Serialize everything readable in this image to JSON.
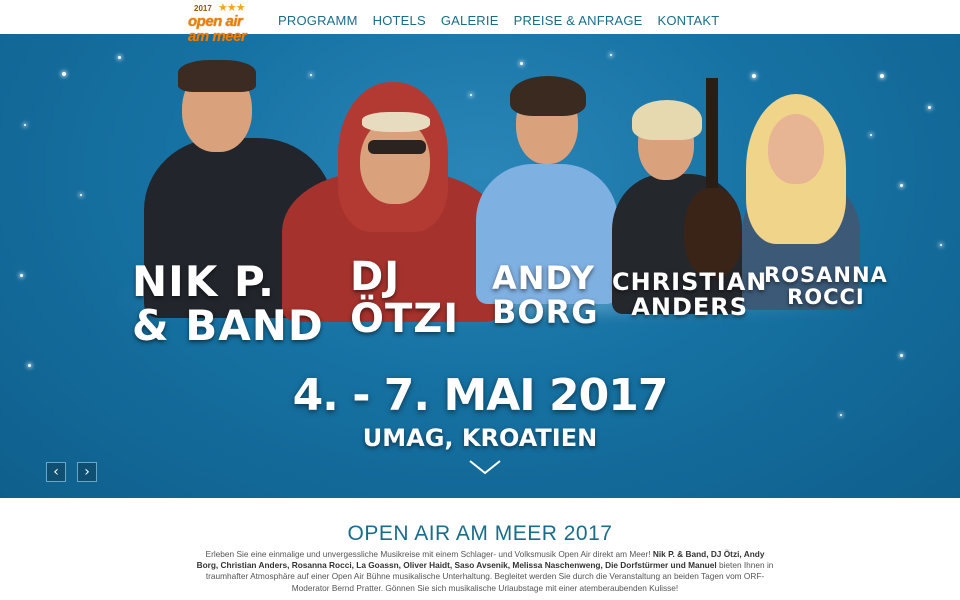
{
  "brand": {
    "logo_year": "2017",
    "logo_stars": "★★★",
    "logo_line1": "open air",
    "logo_line2": "am meer",
    "colors": {
      "logo_orange": "#ee7f00",
      "nav_blue": "#1a6d8a",
      "hero_blue": "#1672a3"
    }
  },
  "nav": {
    "items": [
      {
        "label": "PROGRAMM"
      },
      {
        "label": "HOTELS"
      },
      {
        "label": "GALERIE"
      },
      {
        "label": "PREISE & ANFRAGE"
      },
      {
        "label": "KONTAKT"
      }
    ]
  },
  "hero": {
    "artists": [
      {
        "name": "NIK P.\n& BAND"
      },
      {
        "name": "DJ\nÖTZI"
      },
      {
        "name": "ANDY\nBORG"
      },
      {
        "name": "CHRISTIAN\nANDERS"
      },
      {
        "name": "ROSANNA\nROCCI"
      }
    ],
    "date": "4. - 7. MAI 2017",
    "location": "UMAG, KROATIEN",
    "prev_icon": "chevron-left-icon",
    "next_icon": "chevron-right-icon",
    "scroll_icon": "chevron-down-icon",
    "prev_glyph": "‹",
    "next_glyph": "›"
  },
  "content": {
    "title": "OPEN AIR AM MEER 2017",
    "intro_before": "Erleben Sie eine einmalige und unvergessliche Musikreise mit einem Schlager- und Volksmusik Open Air direkt am Meer! ",
    "intro_bold": "Nik P. & Band, DJ Ötzi, Andy Borg, Christian Anders, Rosanna Rocci, La Goassn, Oliver Haidt, Saso Avsenik, Melissa Naschenweng, Die Dorfstürmer und Manuel",
    "intro_after": " bieten Ihnen in traumhafter Atmosphäre auf einer Open Air Bühne musikalische Unterhaltung. Begleitet werden Sie durch die Veranstaltung an beiden Tagen vom ORF-Moderator Bernd Pratter. Gönnen Sie sich musikalische Urlaubstage mit einer atemberaubenden Kulisse!"
  }
}
